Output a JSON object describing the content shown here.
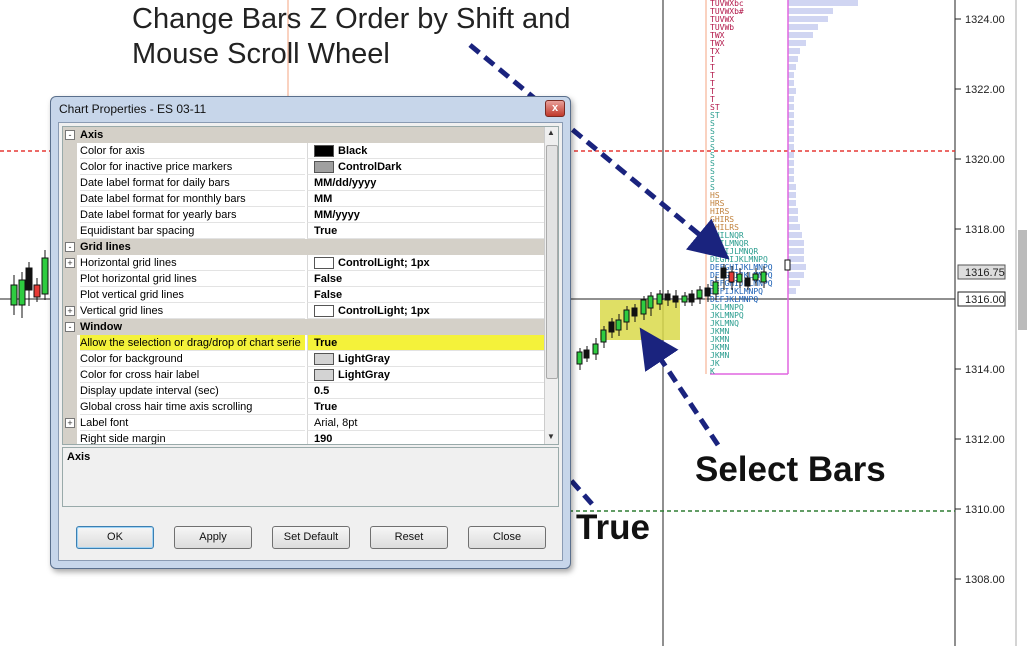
{
  "annotations": {
    "top_line1": "Change Bars Z Order by Shift and",
    "top_line2": "Mouse Scroll Wheel",
    "select_bars": "Select Bars",
    "true_label": "True"
  },
  "price_axis": {
    "labels": [
      "1324.00",
      "1322.00",
      "1320.00",
      "1318.00",
      "1316.75",
      "1316.00",
      "1314.00",
      "1312.00",
      "1310.00",
      "1308.00"
    ]
  },
  "dialog": {
    "title": "Chart Properties - ES 03-11",
    "close_glyph": "x",
    "rows": [
      {
        "type": "category",
        "toggle": "-",
        "label": "Axis"
      },
      {
        "type": "prop",
        "name": "Color for axis",
        "value": "Black",
        "swatch": "#000000"
      },
      {
        "type": "prop",
        "name": "Color for inactive price markers",
        "value": "ControlDark",
        "swatch": "#a0a0a0"
      },
      {
        "type": "prop",
        "name": "Date label format for daily bars",
        "value": "MM/dd/yyyy"
      },
      {
        "type": "prop",
        "name": "Date label format for monthly bars",
        "value": "MM"
      },
      {
        "type": "prop",
        "name": "Date label format for yearly bars",
        "value": "MM/yyyy"
      },
      {
        "type": "prop",
        "name": "Equidistant bar spacing",
        "value": "True"
      },
      {
        "type": "category",
        "toggle": "-",
        "label": "Grid lines"
      },
      {
        "type": "prop",
        "toggle": "+",
        "name": "Horizontal grid lines",
        "value": "ControlLight; 1px",
        "swatch": "#ffffff"
      },
      {
        "type": "prop",
        "name": "Plot horizontal grid lines",
        "value": "False"
      },
      {
        "type": "prop",
        "name": "Plot vertical grid lines",
        "value": "False"
      },
      {
        "type": "prop",
        "toggle": "+",
        "name": "Vertical grid lines",
        "value": "ControlLight; 1px",
        "swatch": "#ffffff"
      },
      {
        "type": "category",
        "toggle": "-",
        "label": "Window"
      },
      {
        "type": "prop",
        "name": "Allow the selection or drag/drop of chart serie",
        "value": "True",
        "highlight": true
      },
      {
        "type": "prop",
        "name": "Color for background",
        "value": "LightGray",
        "swatch": "#d3d3d3"
      },
      {
        "type": "prop",
        "name": "Color for cross hair label",
        "value": "LightGray",
        "swatch": "#d3d3d3"
      },
      {
        "type": "prop",
        "name": "Display update interval (sec)",
        "value": "0.5"
      },
      {
        "type": "prop",
        "name": "Global cross hair time axis scrolling",
        "value": "True"
      },
      {
        "type": "prop",
        "toggle": "+",
        "name": "Label font",
        "value": "Arial, 8pt",
        "normal": true
      },
      {
        "type": "prop",
        "name": "Right side margin",
        "value": "190"
      }
    ],
    "description_title": "Axis",
    "buttons": {
      "ok": "OK",
      "apply": "Apply",
      "set_default": "Set Default",
      "reset": "Reset",
      "close": "Close"
    }
  },
  "colors": {
    "highlight": "#f4f23a",
    "selection_box": "#d9d94a",
    "arrow": "#1a237e",
    "bar_up": "#2ecc40",
    "dash_red": "#e53935",
    "dash_green": "#2e7d32"
  }
}
